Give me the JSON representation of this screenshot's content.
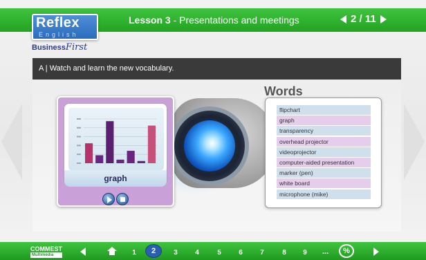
{
  "header": {
    "logo_main": "Reflex",
    "logo_sub": "English",
    "logo_business": "Business",
    "logo_first": "First",
    "lesson_label": "Lesson 3",
    "lesson_topic": " - Presentations and meetings",
    "pager_current": "2",
    "pager_total": "11",
    "pager_text": "2 / 11"
  },
  "instruction": {
    "text": "A | Watch and learn the new vocabulary."
  },
  "card": {
    "word": "graph",
    "chart_bar_values": [
      {
        "value": 0.45,
        "color": "#b5336a"
      },
      {
        "value": 0.18,
        "color": "#6a2580"
      },
      {
        "value": 0.95,
        "color": "#5a1f6e"
      },
      {
        "value": 0.08,
        "color": "#6a2580"
      },
      {
        "value": 0.28,
        "color": "#6a2580"
      },
      {
        "value": 0.05,
        "color": "#6a2580"
      },
      {
        "value": 0.85,
        "color": "#c65079"
      }
    ]
  },
  "words": {
    "title": "Words",
    "items": [
      {
        "label": "flipchart",
        "color": "#cfe0ec"
      },
      {
        "label": "graph",
        "color": "#e5cdec"
      },
      {
        "label": "transparency",
        "color": "#cfe0ec"
      },
      {
        "label": "overhead projector",
        "color": "#e5cdec"
      },
      {
        "label": "videoprojector",
        "color": "#cfe0ec"
      },
      {
        "label": "computer-aided presentation",
        "color": "#e5cdec"
      },
      {
        "label": "marker (pen)",
        "color": "#cfe0ec"
      },
      {
        "label": "white board",
        "color": "#e5cdec"
      },
      {
        "label": "microphone (mike)",
        "color": "#cfe0ec"
      }
    ]
  },
  "footer": {
    "brand": "COMMEST",
    "brand_sub": "Multimedia",
    "pages": [
      "1",
      "2",
      "3",
      "4",
      "5",
      "6",
      "7",
      "8",
      "9"
    ],
    "active_page": "2",
    "ellipsis": "...",
    "percent_symbol": "%"
  }
}
